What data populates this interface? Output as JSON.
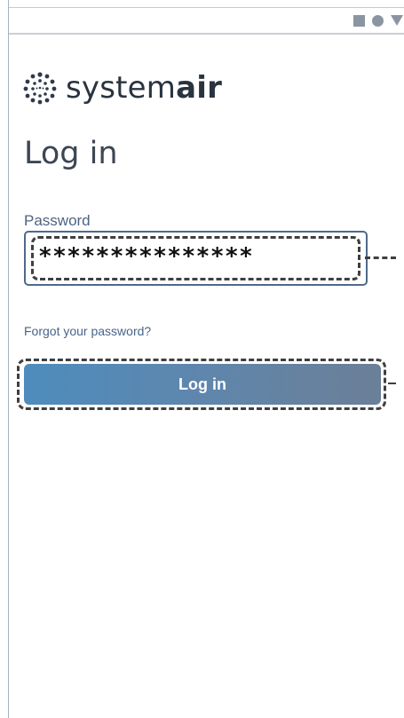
{
  "status_bar": {
    "icons": [
      "square-icon",
      "circle-icon",
      "triangle-down-icon"
    ]
  },
  "logo": {
    "text_regular": "system",
    "text_bold": "air",
    "icon": "systemair-dots-logo-icon"
  },
  "title": "Log in",
  "password": {
    "label": "Password",
    "value": "***************"
  },
  "forgot_link": "Forgot your password?",
  "login_button": "Log in",
  "colors": {
    "button_start": "#4d8cbd",
    "button_end": "#6b7f97",
    "field_border": "#4e6a8c",
    "link": "#48648a",
    "title": "#3d4654"
  }
}
